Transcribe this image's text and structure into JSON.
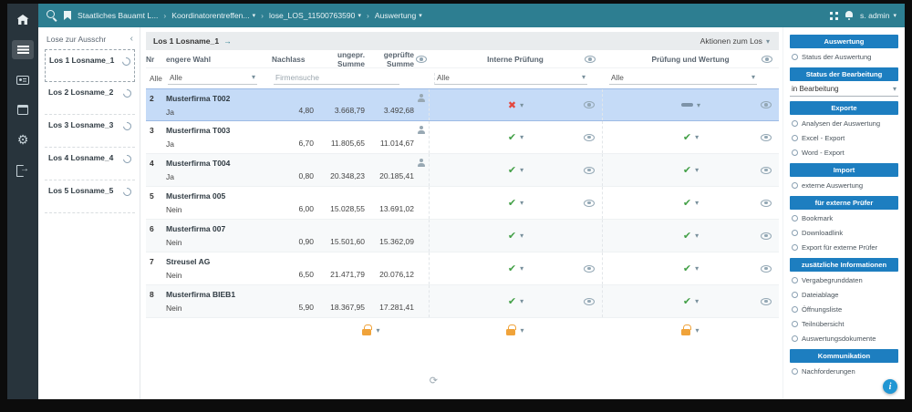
{
  "colors": {
    "topbar": "#2d7e91",
    "sidebar": "#28343c",
    "section_blue": "#1d7ec0",
    "selected_row": "#c5dbf7",
    "check_green": "#43a047",
    "x_red": "#e4473e",
    "lock_orange": "#f0a33a"
  },
  "icons": {
    "topbar": [
      "search-icon",
      "bookmark-icon",
      "apps-grid-icon",
      "bell-icon",
      "caret-down-icon"
    ],
    "sidebar": [
      "home-icon",
      "list-menu-icon",
      "contact-card-icon",
      "calendar-icon",
      "gear-icon",
      "logout-icon"
    ],
    "table": [
      "eye-icon",
      "person-edit-icon",
      "check-approved-icon",
      "x-rejected-icon",
      "dash-pending-icon",
      "lock-icon",
      "chevron-down-icon"
    ],
    "misc": [
      "info-icon",
      "sync-icon",
      "collapse-chevron-icon"
    ]
  },
  "topbar": {
    "breadcrumb": [
      "Staatliches Bauamt L...",
      "Koordinatorentreffen...",
      "lose_LOS_11500763590",
      "Auswertung"
    ],
    "user_label": "s. admin"
  },
  "lots_panel": {
    "title": "Lose zur Ausschr",
    "items": [
      {
        "label": "Los 1 Losname_1",
        "selected": true
      },
      {
        "label": "Los 2 Losname_2",
        "selected": false
      },
      {
        "label": "Los 3 Losname_3",
        "selected": false
      },
      {
        "label": "Los 4 Losname_4",
        "selected": false
      },
      {
        "label": "Los 5 Losname_5",
        "selected": false
      }
    ]
  },
  "main": {
    "title": "Los 1 Losname_1",
    "actions_label": "Aktionen zum Los",
    "table": {
      "headers": {
        "nr": "Nr",
        "engere_wahl": "engere Wahl",
        "nachlass": "Nachlass",
        "ungepr_summe": "ungepr. Summe",
        "gepr_summe": "geprüfte Summe",
        "interne_pruefung": "Interne Prüfung",
        "pruefung_wertung": "Prüfung und Wertung"
      },
      "filters": {
        "alle_text": "Alle",
        "alle_dropdown": "Alle",
        "firmensuche_placeholder": "Firmensuche",
        "interne_filter": "Alle",
        "wertung_filter": "Alle"
      },
      "rows": [
        {
          "nr": "2",
          "firma": "Musterfirma T002",
          "engere_wahl": "Ja",
          "nachlass": "4,80",
          "ungepr": "3.668,79",
          "gepr": "3.492,68",
          "interne_status": "rejected",
          "wertung_status": "none",
          "selected": true,
          "has_person_icon": true
        },
        {
          "nr": "3",
          "firma": "Musterfirma T003",
          "engere_wahl": "Ja",
          "nachlass": "6,70",
          "ungepr": "11.805,65",
          "gepr": "11.014,67",
          "interne_status": "approved",
          "wertung_status": "approved",
          "selected": false,
          "has_person_icon": true
        },
        {
          "nr": "4",
          "firma": "Musterfirma T004",
          "engere_wahl": "Ja",
          "nachlass": "0,80",
          "ungepr": "20.348,23",
          "gepr": "20.185,41",
          "interne_status": "approved",
          "wertung_status": "approved",
          "selected": false,
          "has_person_icon": true
        },
        {
          "nr": "5",
          "firma": "Musterfirma 005",
          "engere_wahl": "Nein",
          "nachlass": "6,00",
          "ungepr": "15.028,55",
          "gepr": "13.691,02",
          "interne_status": "approved",
          "wertung_status": "approved",
          "selected": false,
          "has_person_icon": false
        },
        {
          "nr": "6",
          "firma": "Musterfirma 007",
          "engere_wahl": "Nein",
          "nachlass": "0,90",
          "ungepr": "15.501,60",
          "gepr": "15.362,09",
          "interne_status": "approved",
          "wertung_status": "approved",
          "selected": false,
          "has_person_icon": false
        },
        {
          "nr": "7",
          "firma": "Streusel AG",
          "engere_wahl": "Nein",
          "nachlass": "6,50",
          "ungepr": "21.471,79",
          "gepr": "20.076,12",
          "interne_status": "approved",
          "wertung_status": "approved",
          "selected": false,
          "has_person_icon": false
        },
        {
          "nr": "8",
          "firma": "Musterfirma BIEB1",
          "engere_wahl": "Nein",
          "nachlass": "5,90",
          "ungepr": "18.367,95",
          "gepr": "17.281,41",
          "interne_status": "approved",
          "wertung_status": "approved",
          "selected": false,
          "has_person_icon": false
        }
      ]
    }
  },
  "rightbar": {
    "auswertung_header": "Auswertung",
    "status_auswertung": "Status der Auswertung",
    "bearbeitung_header": "Status der Bearbeitung",
    "bearbeitung_value": "in Bearbeitung",
    "exporte_header": "Exporte",
    "exporte_items": [
      "Analysen der Auswertung",
      "Excel - Export",
      "Word - Export"
    ],
    "import_header": "Import",
    "import_items": [
      "externe Auswertung"
    ],
    "pruefer_header": "für externe Prüfer",
    "pruefer_items": [
      "Bookmark",
      "Downloadlink",
      "Export für externe Prüfer"
    ],
    "zusatz_header": "zusätzliche Informationen",
    "zusatz_items": [
      "Vergabegrunddaten",
      "Dateiablage",
      "Öffnungsliste",
      "Teilnübersicht",
      "Auswertungsdokumente"
    ],
    "komm_header": "Kommunikation",
    "komm_items": [
      "Nachforderungen"
    ]
  }
}
